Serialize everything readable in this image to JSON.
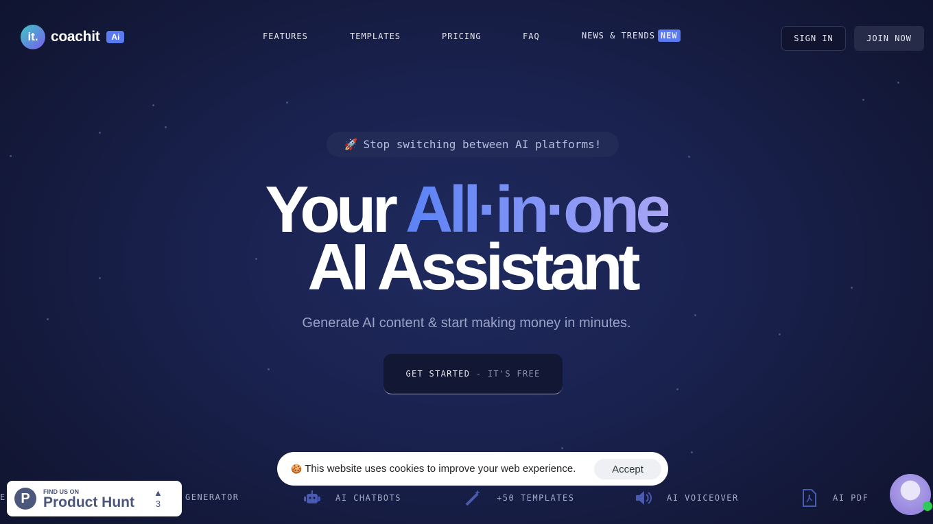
{
  "header": {
    "logo_mark": "it.",
    "logo_text": "coachit",
    "logo_badge": "Ai",
    "nav": [
      {
        "label": "FEATURES"
      },
      {
        "label": "TEMPLATES"
      },
      {
        "label": "PRICING"
      },
      {
        "label": "FAQ"
      },
      {
        "label": "NEWS & TRENDS",
        "badge": "NEW"
      }
    ],
    "sign_in": "SIGN IN",
    "join_now": "JOIN NOW"
  },
  "hero": {
    "pill_icon": "rocket-icon",
    "pill_emoji": "🚀",
    "pill_text": "Stop switching between AI platforms!",
    "title_plain": "Your",
    "title_highlight": "All·in·one",
    "title_line2": "AI Assistant",
    "subtitle": "Generate AI content & start making money in minutes.",
    "cta_main": "GET STARTED",
    "cta_sep": " - ",
    "cta_secondary": "IT'S FREE"
  },
  "features": [
    {
      "label": "E"
    },
    {
      "label": "GENERATOR"
    },
    {
      "label": "AI CHATBOTS",
      "icon": "robot-icon"
    },
    {
      "label": "+50 TEMPLATES",
      "icon": "magic-wand-icon"
    },
    {
      "label": "AI VOICEOVER",
      "icon": "speaker-icon"
    },
    {
      "label": "AI PDF",
      "icon": "pdf-file-icon"
    }
  ],
  "cookie": {
    "emoji": "🍪",
    "text": "This website uses cookies to improve your web experience.",
    "accept": "Accept"
  },
  "product_hunt": {
    "small": "FIND US ON",
    "big": "Product Hunt",
    "votes": "3",
    "arrow": "▲"
  },
  "colors": {
    "accent": "#5a7bf0",
    "background": "#19214d"
  }
}
